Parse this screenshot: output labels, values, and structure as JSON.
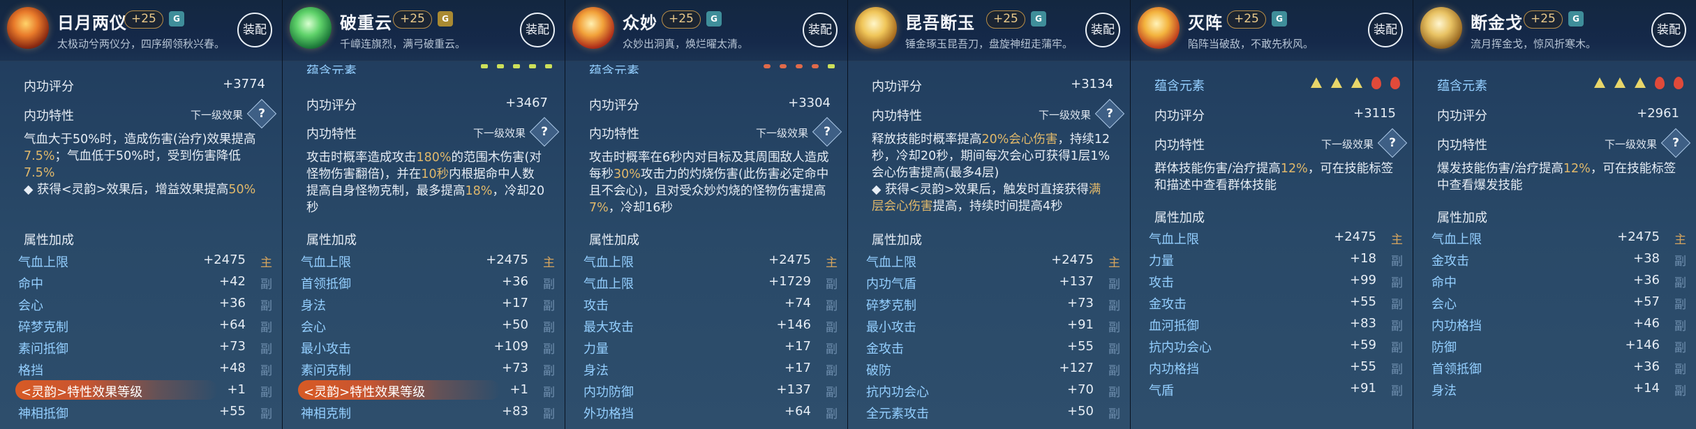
{
  "equip_label": "装配",
  "next_level_label": "下一级效果",
  "question_glyph": "?",
  "labels": {
    "score": "内功评分",
    "trait": "内功特性",
    "attrs": "属性加成",
    "element": "蕴含元素"
  },
  "cards": [
    {
      "name": "日月两仪",
      "level": "+25",
      "grade": "G",
      "desc": "太极动兮两仪分，四序纲领秋兴春。",
      "icon": "sun-moon-icon",
      "score": "+3774",
      "effect_parts": [
        {
          "t": "气血大于50%时，造成伤害(治疗)效果提高",
          "c": ""
        },
        {
          "t": "7.5%",
          "c": "gold"
        },
        {
          "t": "；气血低于50%时，受到伤害降低",
          "c": ""
        },
        {
          "t": "7.5%",
          "c": "gold"
        },
        {
          "t": "\n◆ 获得<灵韵>效果后，增益效果提高",
          "c": ""
        },
        {
          "t": "50%",
          "c": "gold"
        }
      ],
      "attrs": [
        {
          "k": "气血上限",
          "v": "+2475",
          "tag": "主"
        },
        {
          "k": "命中",
          "v": "+42",
          "tag": "副"
        },
        {
          "k": "会心",
          "v": "+36",
          "tag": "副"
        },
        {
          "k": "碎梦克制",
          "v": "+64",
          "tag": "副"
        },
        {
          "k": "素问抵御",
          "v": "+73",
          "tag": "副"
        },
        {
          "k": "格挡",
          "v": "+48",
          "tag": "副"
        },
        {
          "k": "<灵韵>特性效果等级",
          "v": "+1",
          "tag": "副",
          "glow": true
        },
        {
          "k": "神相抵御",
          "v": "+55",
          "tag": "副"
        }
      ]
    },
    {
      "name": "破重云",
      "level": "+25",
      "grade": "G",
      "desc": "千嶂连旗烈，满弓破重云。",
      "icon": "jade-icon",
      "score": "+3467",
      "effect_parts": [
        {
          "t": "攻击时概率造成攻击",
          "c": ""
        },
        {
          "t": "180%",
          "c": "gold"
        },
        {
          "t": "的范围木伤害(对怪物伤害翻倍)，并在",
          "c": ""
        },
        {
          "t": "10秒",
          "c": "gold"
        },
        {
          "t": "内根据命中人数提高自身怪物克制，最多提高",
          "c": ""
        },
        {
          "t": "18%",
          "c": "gold"
        },
        {
          "t": "，冷却20秒",
          "c": ""
        }
      ],
      "attrs": [
        {
          "k": "气血上限",
          "v": "+2475",
          "tag": "主"
        },
        {
          "k": "首领抵御",
          "v": "+36",
          "tag": "副"
        },
        {
          "k": "身法",
          "v": "+17",
          "tag": "副"
        },
        {
          "k": "会心",
          "v": "+50",
          "tag": "副"
        },
        {
          "k": "最小攻击",
          "v": "+109",
          "tag": "副"
        },
        {
          "k": "素问克制",
          "v": "+73",
          "tag": "副"
        },
        {
          "k": "<灵韵>特性效果等级",
          "v": "+1",
          "tag": "副",
          "glow": true
        },
        {
          "k": "神相克制",
          "v": "+83",
          "tag": "副"
        }
      ]
    },
    {
      "name": "众妙",
      "level": "+25",
      "grade": "G",
      "desc": "众妙出洞真，焕烂曜太清。",
      "icon": "flame-orb-icon",
      "score": "+3304",
      "effect_parts": [
        {
          "t": "攻击时概率在6秒内对目标及其周围敌人造成每秒",
          "c": ""
        },
        {
          "t": "30%",
          "c": "gold"
        },
        {
          "t": "攻击力的灼烧伤害(此伤害必定命中且不会心)，且对受众妙灼烧的怪物伤害提高",
          "c": ""
        },
        {
          "t": "7%",
          "c": "gold"
        },
        {
          "t": "，冷却16秒",
          "c": ""
        }
      ],
      "attrs": [
        {
          "k": "气血上限",
          "v": "+2475",
          "tag": "主"
        },
        {
          "k": "气血上限",
          "v": "+1729",
          "tag": "副"
        },
        {
          "k": "攻击",
          "v": "+74",
          "tag": "副"
        },
        {
          "k": "最大攻击",
          "v": "+146",
          "tag": "副"
        },
        {
          "k": "力量",
          "v": "+17",
          "tag": "副"
        },
        {
          "k": "身法",
          "v": "+17",
          "tag": "副"
        },
        {
          "k": "内功防御",
          "v": "+137",
          "tag": "副"
        },
        {
          "k": "外功格挡",
          "v": "+64",
          "tag": "副"
        }
      ]
    },
    {
      "name": "昆吾断玉",
      "level": "+25",
      "grade": "G",
      "desc": "锤金琢玉昆吾刀，盘旋神纽走蒲牢。",
      "icon": "blade-icon",
      "score": "+3134",
      "effect_parts": [
        {
          "t": "释放技能时概率提高",
          "c": ""
        },
        {
          "t": "20%会心伤害",
          "c": "gold"
        },
        {
          "t": "，持续12秒，冷却20秒，期间每次会心可获得1层1%会心伤害提高(最多4层)\n◆ 获得<灵韵>效果后，触发时直接获得",
          "c": ""
        },
        {
          "t": "满层会心伤害",
          "c": "gold"
        },
        {
          "t": "提高，持续时间提高4秒",
          "c": ""
        }
      ],
      "attrs": [
        {
          "k": "气血上限",
          "v": "+2475",
          "tag": "主"
        },
        {
          "k": "内功气盾",
          "v": "+137",
          "tag": "副"
        },
        {
          "k": "碎梦克制",
          "v": "+73",
          "tag": "副"
        },
        {
          "k": "最小攻击",
          "v": "+91",
          "tag": "副"
        },
        {
          "k": "金攻击",
          "v": "+55",
          "tag": "副"
        },
        {
          "k": "破防",
          "v": "+127",
          "tag": "副"
        },
        {
          "k": "抗内功会心",
          "v": "+70",
          "tag": "副"
        },
        {
          "k": "全元素攻击",
          "v": "+50",
          "tag": "副"
        }
      ]
    },
    {
      "name": "灭阵",
      "level": "+25",
      "grade": "G",
      "desc": "陷阵当破敌，不敢先秋风。",
      "icon": "crossed-swords-icon",
      "score": "+3115",
      "elements": [
        "tri",
        "tri",
        "tri",
        "fire",
        "fire"
      ],
      "effect_parts": [
        {
          "t": "群体技能伤害/治疗提高",
          "c": ""
        },
        {
          "t": "12%",
          "c": "gold"
        },
        {
          "t": "，可在技能标签和描述中查看群体技能",
          "c": ""
        }
      ],
      "attrs": [
        {
          "k": "气血上限",
          "v": "+2475",
          "tag": "主"
        },
        {
          "k": "力量",
          "v": "+18",
          "tag": "副"
        },
        {
          "k": "攻击",
          "v": "+99",
          "tag": "副"
        },
        {
          "k": "金攻击",
          "v": "+55",
          "tag": "副"
        },
        {
          "k": "血河抵御",
          "v": "+83",
          "tag": "副"
        },
        {
          "k": "抗内功会心",
          "v": "+59",
          "tag": "副"
        },
        {
          "k": "内功格挡",
          "v": "+55",
          "tag": "副"
        },
        {
          "k": "气盾",
          "v": "+91",
          "tag": "副"
        }
      ]
    },
    {
      "name": "断金戈",
      "level": "+25",
      "grade": "G",
      "desc": "流月挥金戈，惊风折寒木。",
      "icon": "golden-spear-icon",
      "score": "+2961",
      "elements": [
        "tri",
        "tri",
        "tri",
        "fire",
        "fire"
      ],
      "effect_parts": [
        {
          "t": "爆发技能伤害/治疗提高",
          "c": ""
        },
        {
          "t": "12%",
          "c": "gold"
        },
        {
          "t": "，可在技能标签中查看爆发技能",
          "c": ""
        }
      ],
      "attrs": [
        {
          "k": "气血上限",
          "v": "+2475",
          "tag": "主"
        },
        {
          "k": "金攻击",
          "v": "+38",
          "tag": "副"
        },
        {
          "k": "命中",
          "v": "+36",
          "tag": "副"
        },
        {
          "k": "会心",
          "v": "+57",
          "tag": "副"
        },
        {
          "k": "内功格挡",
          "v": "+46",
          "tag": "副"
        },
        {
          "k": "防御",
          "v": "+146",
          "tag": "副"
        },
        {
          "k": "首领抵御",
          "v": "+36",
          "tag": "副"
        },
        {
          "k": "身法",
          "v": "+14",
          "tag": "副"
        }
      ]
    }
  ]
}
